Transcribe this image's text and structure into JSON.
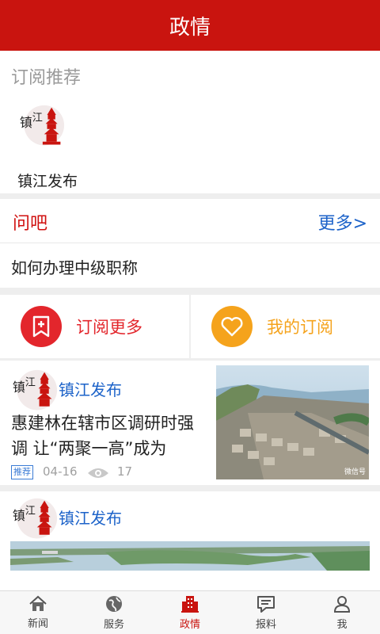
{
  "header": {
    "title": "政情"
  },
  "subscription": {
    "section_title": "订阅推荐",
    "items": [
      {
        "name": "镇江发布",
        "logo_icon": "zhenjiang-pagoda-logo"
      }
    ]
  },
  "wenba": {
    "title": "问吧",
    "more_label": "更多>",
    "question": "如何办理中级职称"
  },
  "actions": {
    "subscribe_more": {
      "label": "订阅更多",
      "color": "#e3262c"
    },
    "my_subscriptions": {
      "label": "我的订阅",
      "color": "#f5a31c"
    }
  },
  "feed": [
    {
      "source": "镇江发布",
      "title": "惠建林在辖市区调研时强调 让“两聚一高”成为",
      "tag": "推荐",
      "date": "04-16",
      "views": "17",
      "watermark": "微信号"
    },
    {
      "source": "镇江发布"
    }
  ],
  "tabbar": {
    "items": [
      {
        "label": "新闻",
        "icon": "home-icon"
      },
      {
        "label": "服务",
        "icon": "globe-icon"
      },
      {
        "label": "政情",
        "icon": "building-icon",
        "active": true
      },
      {
        "label": "报料",
        "icon": "chat-icon"
      },
      {
        "label": "我",
        "icon": "person-icon"
      }
    ]
  },
  "colors": {
    "brand_red": "#c9140f",
    "link_blue": "#1d63c9"
  }
}
